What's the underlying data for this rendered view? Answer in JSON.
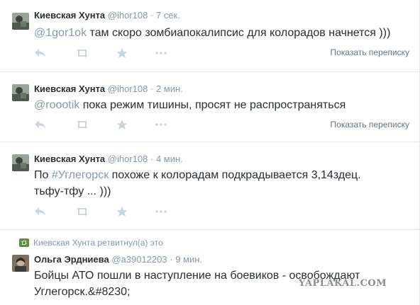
{
  "colors": {
    "text": "#292f33",
    "muted": "#8899a6",
    "divider": "#e1e8ed",
    "retweet_green": "#5c913b"
  },
  "tweets": [
    {
      "fullname": "Киевская Хунта",
      "handle": "@ihor108",
      "separator": "·",
      "time": "7 сек.",
      "mention": "@1gor1ok",
      "text": " там скоро зомбиапокалипсис для колорадов начнется )))",
      "conversation_label": "Показать переписку",
      "avatar_icon": "avatar-icon"
    },
    {
      "fullname": "Киевская Хунта",
      "handle": "@ihor108",
      "separator": "·",
      "time": "2 мин.",
      "mention": "@roootik",
      "text": " пока режим тишины, просят не распространяться",
      "conversation_label": "Показать переписку",
      "avatar_icon": "avatar-icon"
    },
    {
      "fullname": "Киевская Хунта",
      "handle": "@ihor108",
      "separator": "·",
      "time": "4 мин.",
      "text_prefix": "По ",
      "hashtag": "#Углегорск",
      "text_line1": " похоже к колорадам подкрадывается 3,14здец.",
      "text_line2": "тьфу-тфу ... )))",
      "avatar_icon": "avatar-icon"
    },
    {
      "retweet_context": "Киевская Хунта ретвитнул(а) это",
      "fullname": "Ольга Эрдниева",
      "handle": "@a39012203",
      "separator": "·",
      "time": "9 мин.",
      "text_line1": "Бойцы АТО пошли в наступление на боевиков - освобождают",
      "text_line2": "Углегорск.&#8230;",
      "avatar_icon": "avatar-icon"
    }
  ],
  "watermark": "YAPLAKAL.COM"
}
